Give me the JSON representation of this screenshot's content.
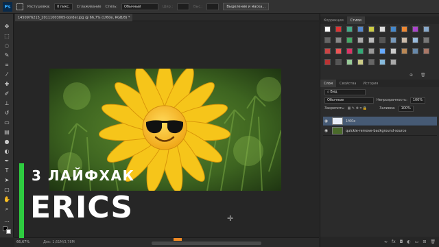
{
  "options_bar": {
    "feather_label": "Растушевка:",
    "feather_value": "0 пикс.",
    "smoothing_label": "Сглаживание",
    "style_label": "Стиль:",
    "style_value": "Обычный",
    "width_label": "Шир.:",
    "height_label": "Выс.:",
    "select_mask_label": "Выделение и маска..."
  },
  "document": {
    "tab_title": "1450976215_20111003005-border.jpg @ 66,7% (1f60e, RGB/8) *"
  },
  "status": {
    "zoom": "66,67%",
    "doc_size": "Док: 1,61М/3,78М"
  },
  "top_panel": {
    "tabs": [
      "Коррекция",
      "Стили"
    ],
    "active_tab": "Стили"
  },
  "layers_panel": {
    "tabs": [
      "Слои",
      "Свойства",
      "История"
    ],
    "active_tab": "Слои",
    "filter_label": "Вид",
    "blend_mode": "Обычные",
    "opacity_label": "Непрозрачность:",
    "opacity_value": "100%",
    "lock_label": "Закрепить:",
    "fill_label": "Заливка:",
    "fill_value": "100%",
    "layers": [
      {
        "name": "1f60e",
        "active": true
      },
      {
        "name": "quickie-remove-background-source",
        "active": false
      }
    ]
  },
  "overlay": {
    "subtitle": "3 ЛАЙФХАК",
    "title": "ERICS",
    "accent_color": "#2ecc40"
  },
  "icons": {
    "tools": [
      "move-icon",
      "marquee-icon",
      "lasso-icon",
      "quick-select-icon",
      "crop-icon",
      "eyedropper-icon",
      "healing-icon",
      "brush-icon",
      "stamp-icon",
      "history-brush-icon",
      "eraser-icon",
      "gradient-icon",
      "blur-icon",
      "dodge-icon",
      "pen-icon",
      "type-icon",
      "path-select-icon",
      "shape-icon",
      "hand-icon",
      "zoom-icon"
    ]
  }
}
